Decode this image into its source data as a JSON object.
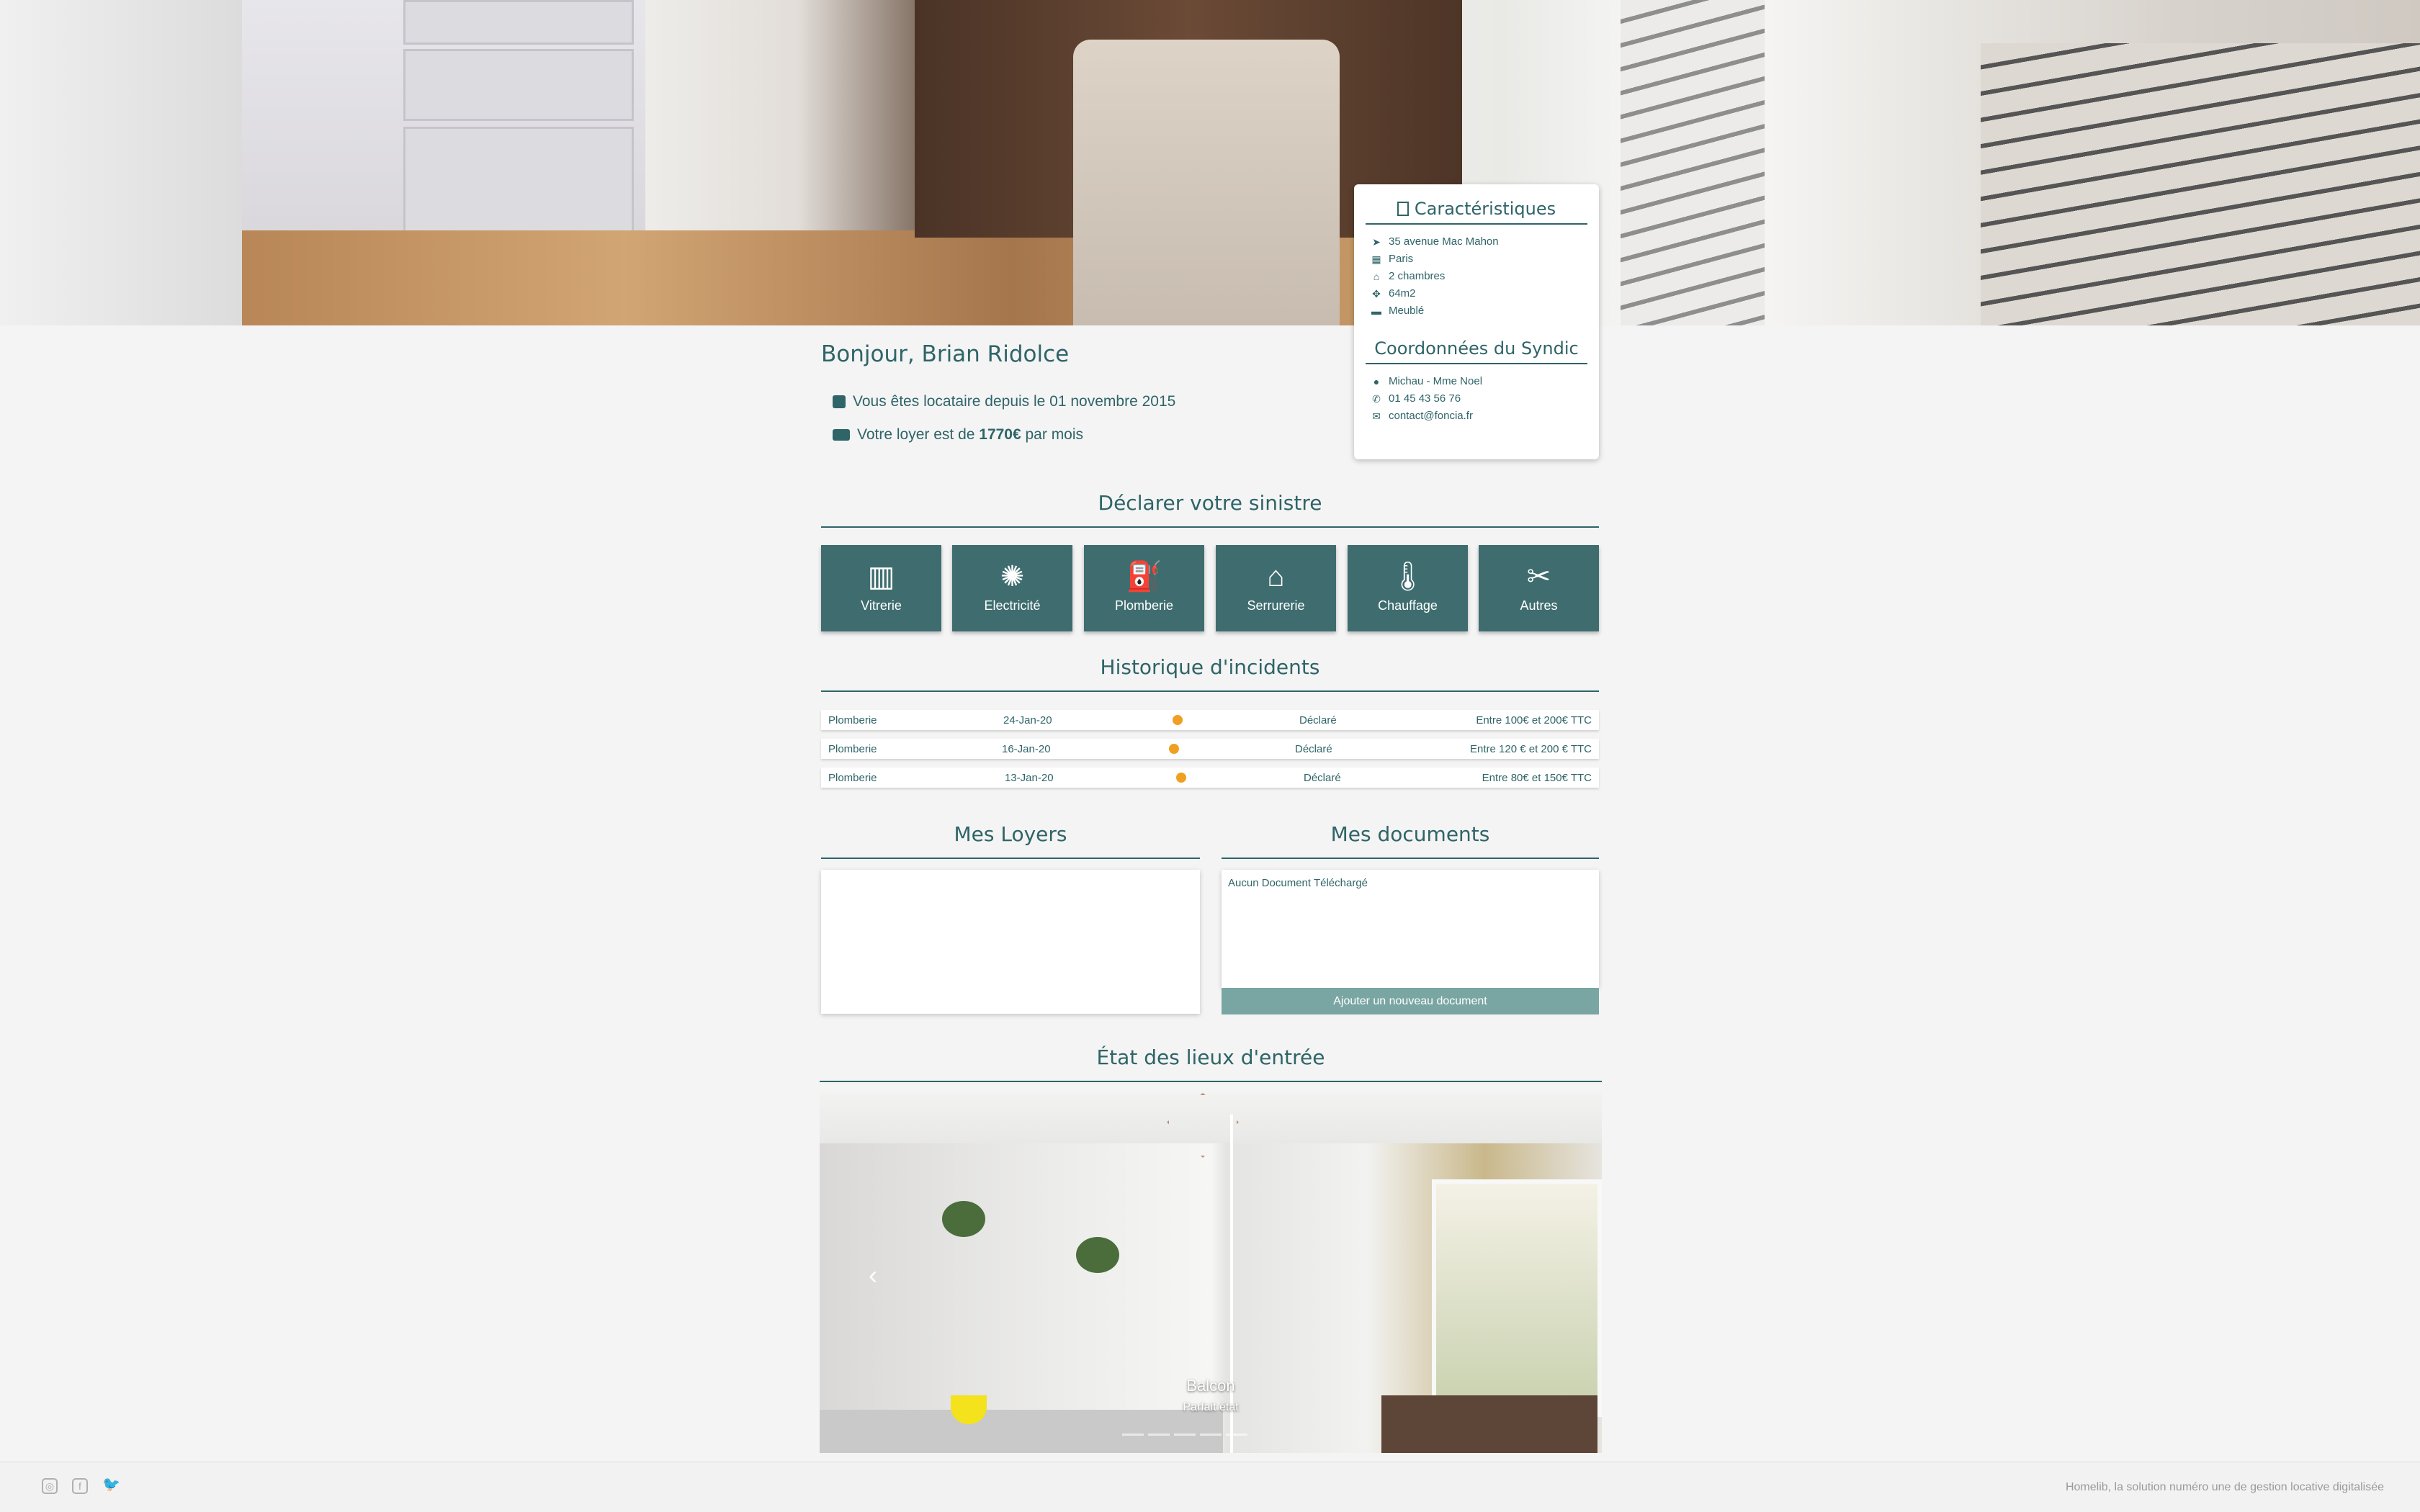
{
  "characteristics": {
    "title": "Caractéristiques",
    "rows": [
      {
        "icon": "location-arrow-icon",
        "text": "35 avenue Mac Mahon"
      },
      {
        "icon": "city-icon",
        "text": "Paris"
      },
      {
        "icon": "home-icon",
        "text": "2 chambres"
      },
      {
        "icon": "arrows-icon",
        "text": "64m2"
      },
      {
        "icon": "couch-icon",
        "text": "Meublé"
      }
    ]
  },
  "syndic": {
    "title": "Coordonnées du Syndic",
    "rows": [
      {
        "icon": "user-icon",
        "text": "Michau - Mme Noel"
      },
      {
        "icon": "phone-icon",
        "text": "01 45 43 56 76"
      },
      {
        "icon": "envelope-icon",
        "text": "contact@foncia.fr"
      }
    ]
  },
  "welcome": {
    "greeting": "Bonjour, Brian Ridolce",
    "tenant_since": "Vous êtes locataire depuis le 01 novembre 2015",
    "rent_prefix": "Votre loyer est de ",
    "rent_amount": "1770€",
    "rent_suffix": " par mois"
  },
  "declare": {
    "title": "Déclarer votre sinistre",
    "tiles": [
      {
        "label": "Vitrerie",
        "icon": "window-icon"
      },
      {
        "label": "Electricité",
        "icon": "lightbulb-icon"
      },
      {
        "label": "Plomberie",
        "icon": "faucet-icon"
      },
      {
        "label": "Serrurerie",
        "icon": "house-lock-icon"
      },
      {
        "label": "Chauffage",
        "icon": "thermometer-icon"
      },
      {
        "label": "Autres",
        "icon": "tools-icon"
      }
    ]
  },
  "history": {
    "title": "Historique d'incidents",
    "rows": [
      {
        "type": "Plomberie",
        "date": "24-Jan-20",
        "status": "Déclaré",
        "cost": "Entre 100€ et 200€ TTC"
      },
      {
        "type": "Plomberie",
        "date": "16-Jan-20",
        "status": "Déclaré",
        "cost": "Entre 120 € et 200 € TTC"
      },
      {
        "type": "Plomberie",
        "date": "13-Jan-20",
        "status": "Déclaré",
        "cost": "Entre 80€ et 150€ TTC"
      }
    ],
    "status_color": "#f0a020"
  },
  "loyers": {
    "title": "Mes Loyers"
  },
  "documents": {
    "title": "Mes documents",
    "empty_text": "Aucun Document Téléchargé",
    "add_button": "Ajouter un nouveau document"
  },
  "etat": {
    "title": "État des lieux d'entrée",
    "slide_title": "Balcon",
    "slide_subtitle": "Parfait état"
  },
  "footer": {
    "tagline": "Homelib, la solution numéro une de gestion locative digitalisée",
    "social": [
      "instagram-icon",
      "facebook-icon",
      "twitter-icon"
    ]
  },
  "colors": {
    "primary": "#2f6468",
    "tile": "#3f6d6f",
    "button": "#79a6a3",
    "status": "#f0a020"
  }
}
